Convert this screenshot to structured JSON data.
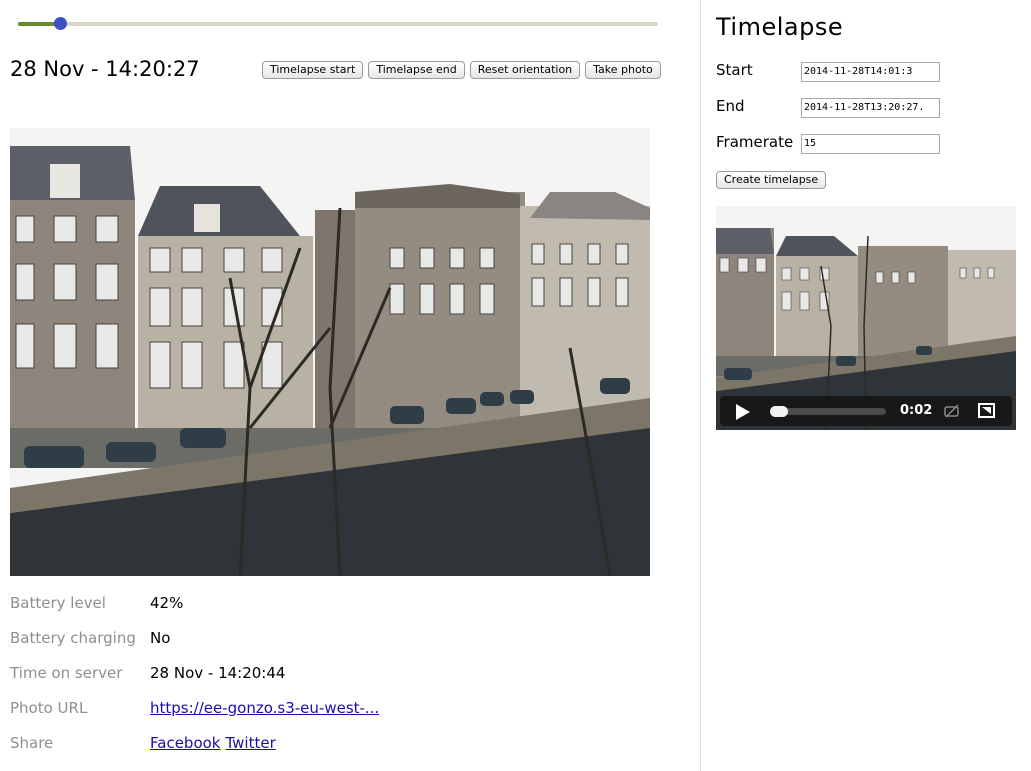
{
  "slider": {
    "progress_fraction": 0.066,
    "fill_color": "#6f8a2b",
    "thumb_color": "#3f4fc7"
  },
  "current_time": "28 Nov - 14:20:27",
  "actions": {
    "timelapse_start": "Timelapse start",
    "timelapse_end": "Timelapse end",
    "reset_orientation": "Reset orientation",
    "take_photo": "Take photo"
  },
  "info": [
    {
      "label": "Battery level",
      "value": "42%"
    },
    {
      "label": "Battery charging",
      "value": "No"
    },
    {
      "label": "Time on server",
      "value": "28 Nov - 14:20:44"
    },
    {
      "label": "Photo URL",
      "value": "https://ee-gonzo.s3-eu-west-..."
    },
    {
      "label": "Share",
      "links": [
        "Facebook",
        "Twitter"
      ]
    }
  ],
  "timelapse": {
    "title": "Timelapse",
    "start_label": "Start",
    "start_value": "2014-11-28T14:01:3",
    "end_label": "End",
    "end_value": "2014-11-28T13:20:27.",
    "framerate_label": "Framerate",
    "framerate_value": "15",
    "create_label": "Create timelapse"
  },
  "video": {
    "time": "0:02",
    "progress_fraction": 0.0
  },
  "colors": {
    "link": "#1a0dab",
    "label_gray": "#8f8f8f"
  }
}
